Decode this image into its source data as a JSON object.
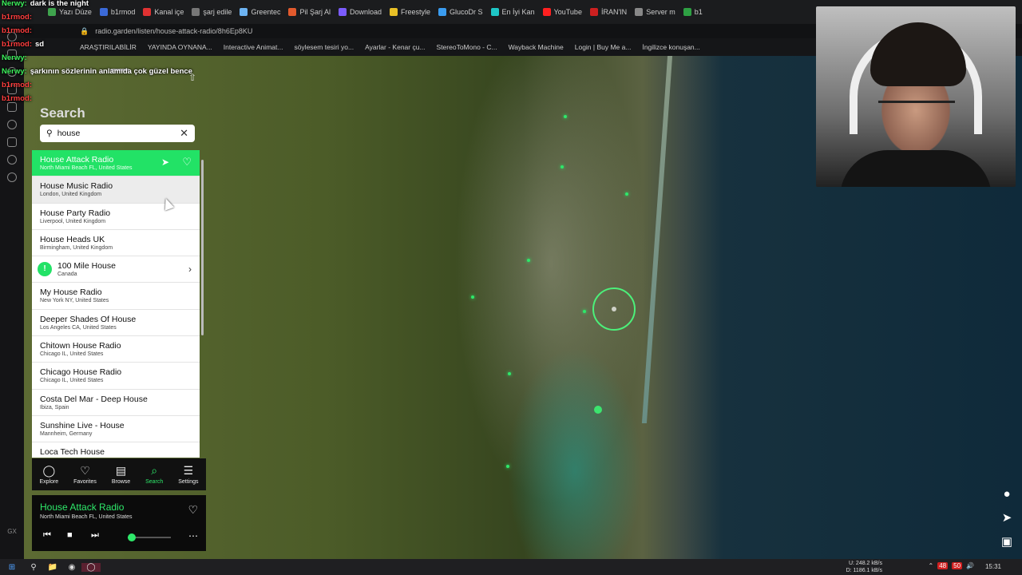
{
  "browser": {
    "tabs": [
      "Yazı Düze",
      "b1rmod",
      "Kanal içe",
      "şarj edile",
      "Greentec",
      "Pil Şarj Al",
      "Download",
      "Freestyle",
      "GlucoDr S",
      "En İyi Kan",
      "YouTube",
      "İRAN'IN",
      "Server m",
      "b1"
    ],
    "url": "radio.garden/listen/house-attack-radio/8h6Ep8KU",
    "bookmarks": [
      "ARAŞTIRILABİLİR",
      "YAYINDA OYNANA...",
      "Interactive Animat...",
      "söylesem tesiri yo...",
      "Ayarlar - Kenar çu...",
      "StereoToMono - C...",
      "Wayback Machine",
      "Login | Buy Me a...",
      "İngilizce konuşan..."
    ],
    "side_label": "GX"
  },
  "chat": [
    {
      "name": "Nerwy:",
      "msg": "dark is the night",
      "color": "g"
    },
    {
      "name": "b1rmod:",
      "msg": "",
      "color": "r"
    },
    {
      "name": "b1rmod:",
      "msg": "",
      "color": "r"
    },
    {
      "name": "b1rmod:",
      "msg": "sd",
      "color": "r"
    },
    {
      "name": "Nerwy:",
      "msg": "",
      "color": "g"
    },
    {
      "name": "Nerwy:",
      "msg": "şarkının sözlerinin anlamıda çok güzel bence",
      "color": "g"
    },
    {
      "name": "b1rmod:",
      "msg": "",
      "color": "r"
    },
    {
      "name": "b1rmod:",
      "msg": "",
      "color": "r"
    }
  ],
  "search": {
    "title": "Search",
    "query": "house"
  },
  "results": [
    {
      "name": "House Attack Radio",
      "location": "North Miami Beach FL, United States",
      "state": "active"
    },
    {
      "name": "House Music Radio",
      "location": "London, United Kingdom",
      "state": "hover"
    },
    {
      "name": "House Party Radio",
      "location": "Liverpool, United Kingdom",
      "state": ""
    },
    {
      "name": "House Heads UK",
      "location": "Birmingham, United Kingdom",
      "state": ""
    },
    {
      "name": "100 Mile House",
      "location": "Canada",
      "state": "place"
    },
    {
      "name": "My House Radio",
      "location": "New York NY, United States",
      "state": ""
    },
    {
      "name": "Deeper Shades Of House",
      "location": "Los Angeles CA, United States",
      "state": ""
    },
    {
      "name": "Chitown House Radio",
      "location": "Chicago IL, United States",
      "state": ""
    },
    {
      "name": "Chicago House Radio",
      "location": "Chicago IL, United States",
      "state": ""
    },
    {
      "name": "Costa Del Mar - Deep House",
      "location": "Ibiza, Spain",
      "state": ""
    },
    {
      "name": "Sunshine Live - House",
      "location": "Mannheim, Germany",
      "state": ""
    },
    {
      "name": "Loca Tech House",
      "location": "",
      "state": ""
    }
  ],
  "tabs": [
    {
      "label": "Explore",
      "icon": "explore-icon",
      "active": false
    },
    {
      "label": "Favorites",
      "icon": "heart-icon",
      "active": false
    },
    {
      "label": "Browse",
      "icon": "map-icon",
      "active": false
    },
    {
      "label": "Search",
      "icon": "search-icon",
      "active": true
    },
    {
      "label": "Settings",
      "icon": "menu-icon",
      "active": false
    }
  ],
  "player": {
    "station": "House Attack Radio",
    "location": "North Miami Beach FL, United States",
    "volume": 0.1
  },
  "taskbar": {
    "net_up": "248.2 kB/s",
    "net_down": "1186.1 kB/s",
    "net_up_label": "U:",
    "net_down_label": "D:",
    "badge1": "48",
    "badge2": "50",
    "time": "15:31"
  },
  "colors": {
    "accent": "#22e266",
    "panel_bg": "#ffffff",
    "chat_green": "#3cf05c",
    "chat_red": "#ff3e3e"
  }
}
